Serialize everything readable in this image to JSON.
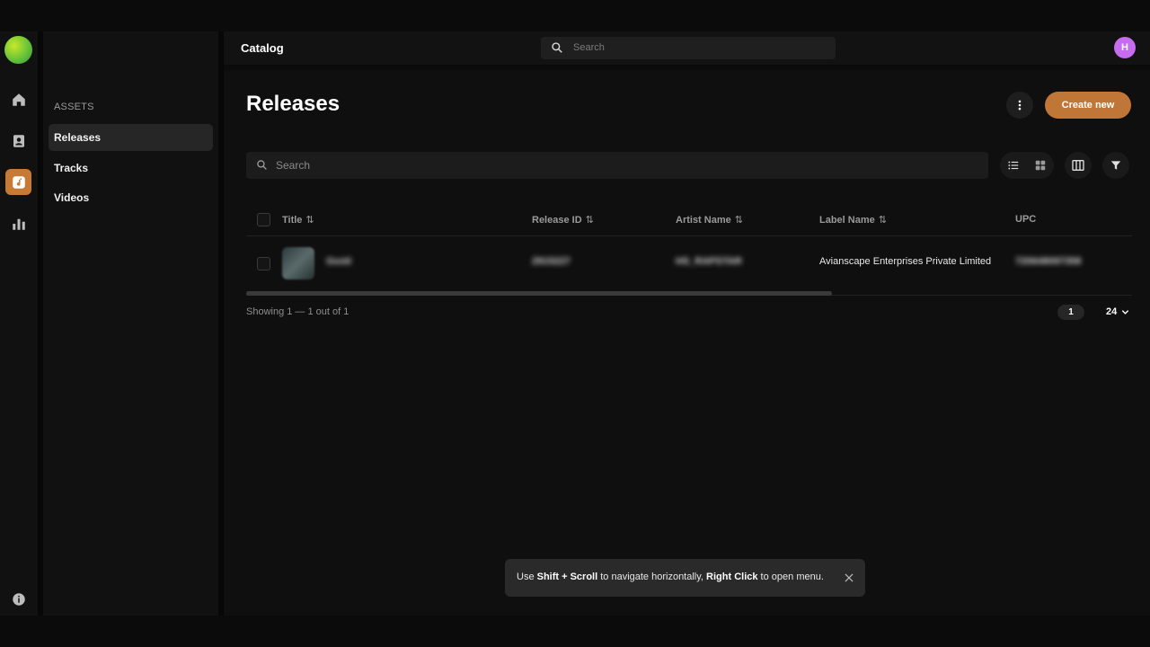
{
  "rail": {
    "icons": [
      "home-icon",
      "contacts-icon",
      "music-note-icon",
      "bar-chart-icon",
      "info-icon"
    ]
  },
  "sidebar": {
    "section": "ASSETS",
    "items": [
      {
        "label": "Releases",
        "active": true
      },
      {
        "label": "Tracks",
        "active": false
      },
      {
        "label": "Videos",
        "active": false
      }
    ]
  },
  "header": {
    "title": "Catalog",
    "search_placeholder": "Search",
    "avatar_initial": "H"
  },
  "main": {
    "title": "Releases",
    "create_label": "Create new",
    "search_placeholder": "Search",
    "columns": [
      "Title",
      "Release ID",
      "Artist Name",
      "Label Name",
      "UPC"
    ],
    "rows": [
      {
        "title": "Gosti",
        "release_id": "2915227",
        "artist": "HS_RAPSTAR",
        "label": "Avianscape Enterprises Private Limited",
        "upc": "720648097358"
      }
    ],
    "showing": "Showing 1 — 1 out of 1",
    "page": "1",
    "per_page": "24"
  },
  "toast": {
    "p1": "Use ",
    "b1": "Shift + Scroll",
    "p2": " to navigate horizontally, ",
    "b2": "Right Click",
    "p3": " to open menu."
  },
  "colors": {
    "accent": "#c07636",
    "avatar": "#c76bf0",
    "background": "#0f0f0f"
  }
}
